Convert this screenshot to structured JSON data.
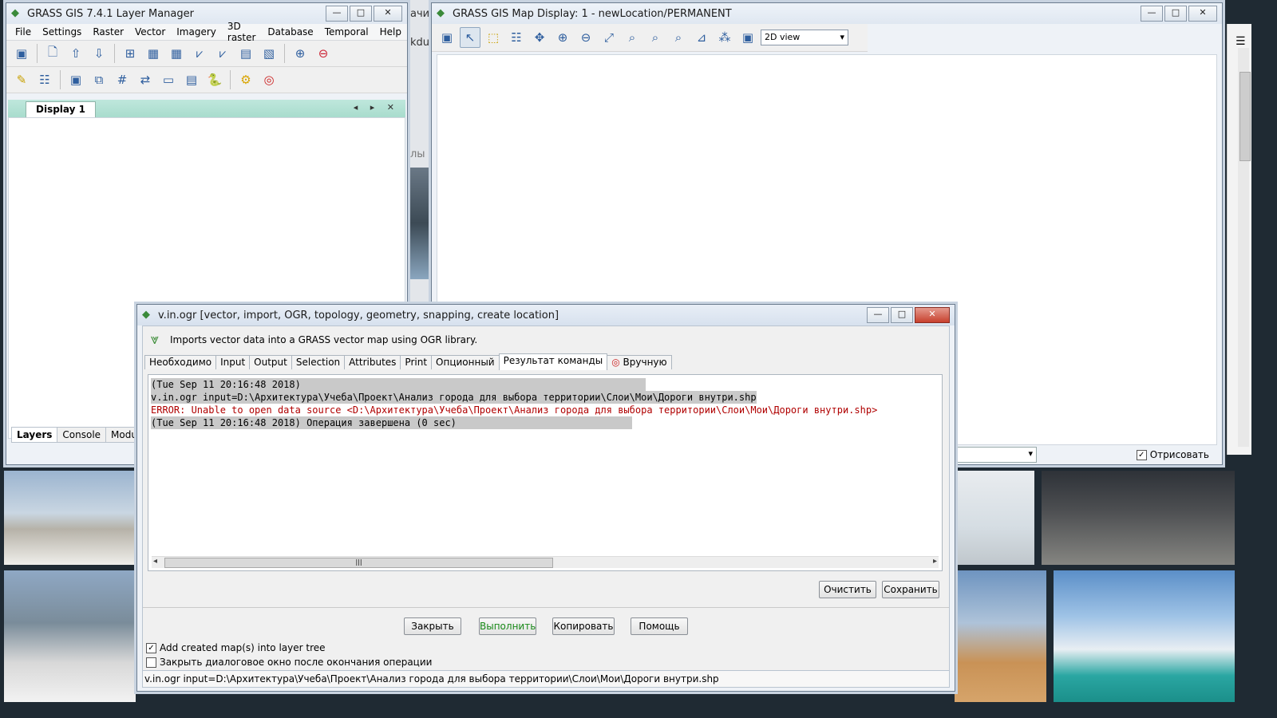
{
  "layer_manager": {
    "title": "GRASS GIS 7.4.1 Layer Manager",
    "menu": [
      "File",
      "Settings",
      "Raster",
      "Vector",
      "Imagery",
      "3D raster",
      "Database",
      "Temporal",
      "Help"
    ],
    "display_tab": "Display 1",
    "bottom_tabs": [
      "Layers",
      "Console",
      "Modules"
    ]
  },
  "map_display": {
    "title": "GRASS GIS Map Display: 1 - newLocation/PERMANENT",
    "view_mode": "2D view",
    "render_label": "Отрисовать"
  },
  "dialog": {
    "title": "v.in.ogr [vector, import, OGR, topology, geometry, snapping, create location]",
    "description": "Imports vector data into a GRASS vector map using OGR library.",
    "tabs": [
      "Необходимо",
      "Input",
      "Output",
      "Selection",
      "Attributes",
      "Print",
      "Опционный",
      "Результат команды",
      "Вручную"
    ],
    "log": [
      "(Tue Sep 11 20:16:48 2018)",
      "v.in.ogr input=D:\\Архитектура\\Учеба\\Проект\\Анализ города для выбора территории\\Слои\\Мои\\Дороги внутри.shp",
      "ERROR: Unable to open data source <D:\\Архитектура\\Учеба\\Проект\\Анализ города для выбора территории\\Слои\\Мои\\Дороги внутри.shp>",
      "(Tue Sep 11 20:16:48 2018) Операция завершена (0 sec)"
    ],
    "clear_label": "Очистить",
    "save_label": "Сохранить",
    "close_label": "Закрыть",
    "run_label": "Выполнить",
    "copy_label": "Копировать",
    "help_label": "Помощь",
    "add_to_tree_label": "Add created map(s) into layer tree",
    "close_after_label": "Закрыть диалоговое окно после окончания операции",
    "command": "v.in.ogr input=D:\\Архитектура\\Учеба\\Проект\\Анализ города для выбора территории\\Слои\\Мои\\Дороги внутри.shp"
  },
  "background": {
    "fragment_1": "ачи",
    "fragment_2": "kdu",
    "fragment_3": "лы"
  }
}
